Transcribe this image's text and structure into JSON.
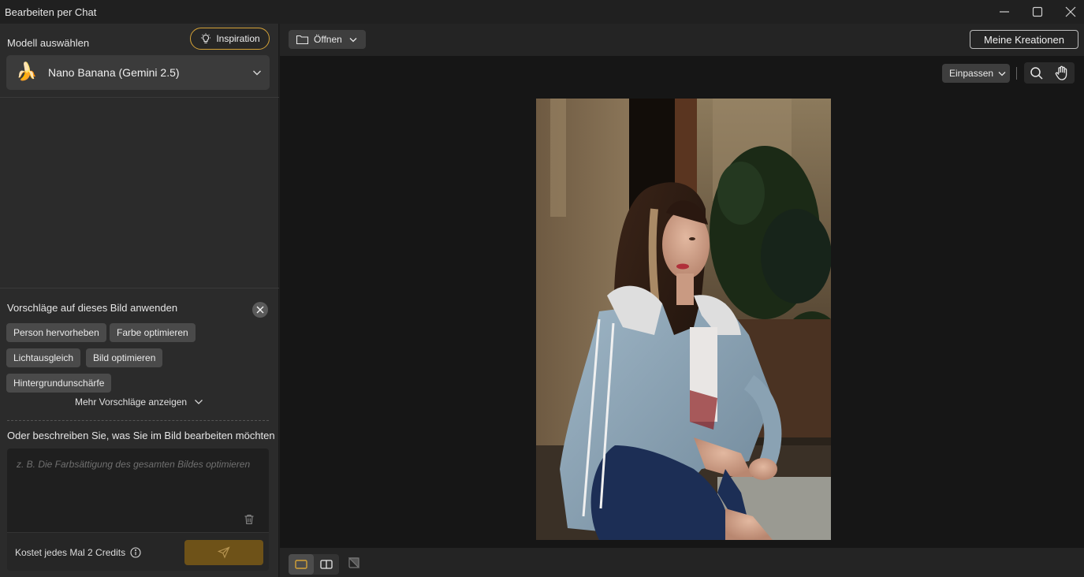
{
  "window": {
    "title": "Bearbeiten per Chat"
  },
  "sidebar": {
    "model_label": "Modell auswählen",
    "inspiration_label": "Inspiration",
    "model_icon": "🍌",
    "model_name": "Nano Banana (Gemini 2.5)",
    "suggestions_title": "Vorschläge auf dieses Bild anwenden",
    "suggestions": [
      {
        "label": "Person hervorheben"
      },
      {
        "label": "Farbe optimieren"
      },
      {
        "label": "Lichtausgleich"
      },
      {
        "label": "Bild optimieren"
      },
      {
        "label": "Hintergrundunschärfe"
      }
    ],
    "more_suggestions": "Mehr Vorschläge anzeigen",
    "describe_label": "Oder beschreiben Sie, was Sie im Bild bearbeiten möchten",
    "prompt_placeholder": "z. B. Die Farbsättigung des gesamten Bildes optimieren",
    "prompt_value": "",
    "credits_text": "Kostet jedes Mal 2 Credits"
  },
  "toolbar": {
    "open_label": "Öffnen",
    "creations_label": "Meine Kreationen"
  },
  "canvas": {
    "fit_label": "Einpassen"
  },
  "colors": {
    "accent": "#d4a237",
    "send_button": "#6e5218",
    "panel": "#2b2b2b",
    "canvas": "#161616"
  }
}
